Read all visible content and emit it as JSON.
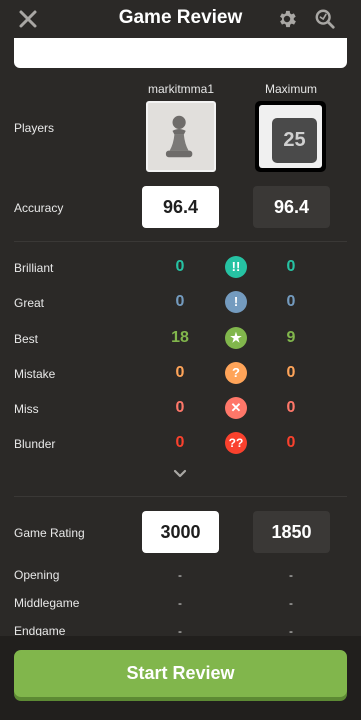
{
  "header": {
    "title": "Game Review",
    "close_icon": "close-icon",
    "settings_icon": "gear-icon",
    "analysis_icon": "magnify-icon"
  },
  "players": {
    "label": "Players",
    "white_name": "markitmma1",
    "black_name": "Maximum",
    "white_avatar_icon": "pawn-icon",
    "black_avatar_label": "25"
  },
  "accuracy": {
    "label": "Accuracy",
    "white": "96.4",
    "black": "96.4"
  },
  "classifications": [
    {
      "label": "Brilliant",
      "white": "0",
      "black": "0",
      "symbol": "!!",
      "color": "#26c2a3"
    },
    {
      "label": "Great",
      "white": "0",
      "black": "0",
      "symbol": "!",
      "color": "#749bbf"
    },
    {
      "label": "Best",
      "white": "18",
      "black": "9",
      "symbol": "★",
      "color": "#81b64c"
    },
    {
      "label": "Mistake",
      "white": "0",
      "black": "0",
      "symbol": "?",
      "color": "#ffa459"
    },
    {
      "label": "Miss",
      "white": "0",
      "black": "0",
      "symbol": "✕",
      "color": "#ff7769"
    },
    {
      "label": "Blunder",
      "white": "0",
      "black": "0",
      "symbol": "??",
      "color": "#fa412d"
    }
  ],
  "game_rating": {
    "label": "Game Rating",
    "white": "3000",
    "black": "1850"
  },
  "phases": [
    {
      "label": "Opening",
      "white": "-",
      "black": "-"
    },
    {
      "label": "Middlegame",
      "white": "-",
      "black": "-"
    },
    {
      "label": "Endgame",
      "white": "-",
      "black": "-"
    }
  ],
  "start_button": "Start Review",
  "colors": {
    "background": "#2b2927",
    "accent_green": "#81b64c"
  }
}
